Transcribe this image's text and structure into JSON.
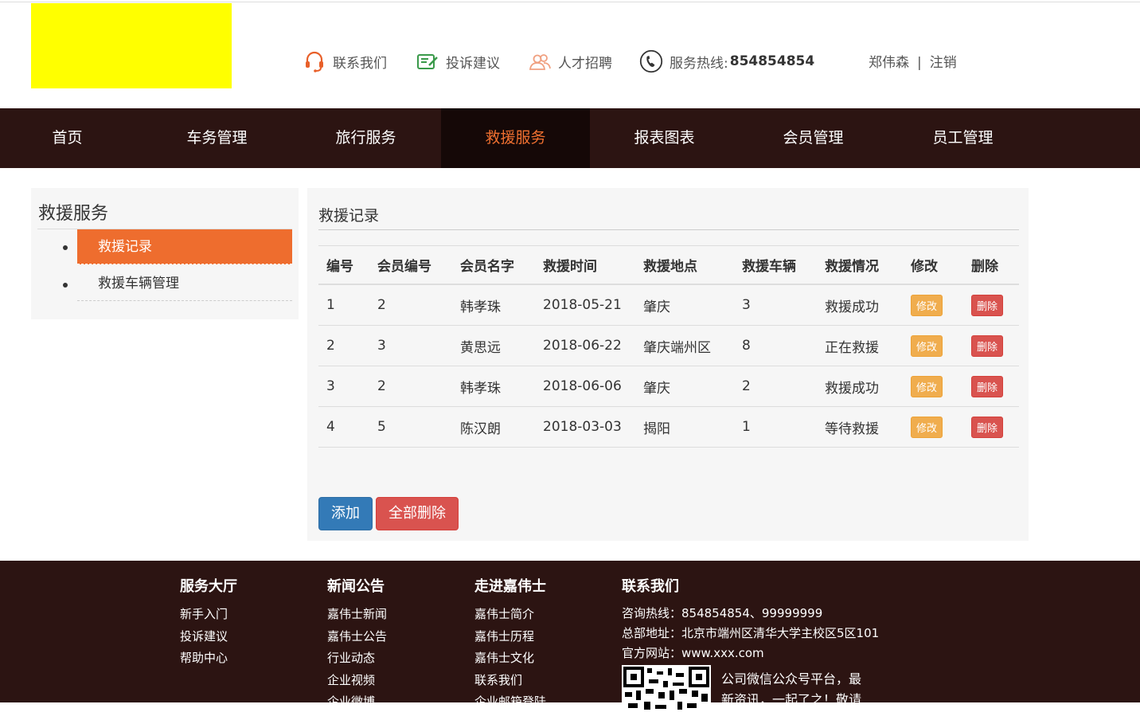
{
  "header": {
    "links": [
      {
        "label": "联系我们",
        "icon": "headset-icon"
      },
      {
        "label": "投诉建议",
        "icon": "edit-icon"
      },
      {
        "label": "人才招聘",
        "icon": "people-icon"
      }
    ],
    "hotline_label": "服务热线:",
    "hotline_number": "854854854",
    "user_name": "郑伟森",
    "separator": "|",
    "logout": "注销",
    "logo_color": "#ffff00"
  },
  "nav": {
    "items": [
      "首页",
      "车务管理",
      "旅行服务",
      "救援服务",
      "报表图表",
      "会员管理",
      "员工管理"
    ],
    "active": "救援服务"
  },
  "sidebar": {
    "title": "救援服务",
    "items": [
      "救援记录",
      "救援车辆管理"
    ],
    "active": "救援记录"
  },
  "main": {
    "title": "救援记录",
    "columns": [
      "编号",
      "会员编号",
      "会员名字",
      "救援时间",
      "救援地点",
      "救援车辆",
      "救援情况",
      "修改",
      "删除"
    ],
    "rows": [
      [
        "1",
        "2",
        "韩孝珠",
        "2018-05-21",
        "肇庆",
        "3",
        "救援成功"
      ],
      [
        "2",
        "3",
        "黄思远",
        "2018-06-22",
        "肇庆端州区",
        "8",
        "正在救援"
      ],
      [
        "3",
        "2",
        "韩孝珠",
        "2018-06-06",
        "肇庆",
        "2",
        "救援成功"
      ],
      [
        "4",
        "5",
        "陈汉朗",
        "2018-03-03",
        "揭阳",
        "1",
        "等待救援"
      ]
    ],
    "edit_label": "修改",
    "delete_label": "删除",
    "add_label": "添加",
    "delete_all_label": "全部删除"
  },
  "footer": {
    "col1": {
      "title": "服务大厅",
      "links": [
        "新手入门",
        "投诉建议",
        "帮助中心"
      ]
    },
    "col2": {
      "title": "新闻公告",
      "links": [
        "嘉伟士新闻",
        "嘉伟士公告",
        "行业动态",
        "企业视频",
        "企业微博"
      ]
    },
    "col3": {
      "title": "走进嘉伟士",
      "links": [
        "嘉伟士简介",
        "嘉伟士历程",
        "嘉伟士文化",
        "联系我们",
        "企业邮箱登陆"
      ]
    },
    "col4": {
      "title": "联系我们",
      "hotline": "咨询热线：854854854、99999999",
      "address": "总部地址：北京市端州区清华大学主校区5区101",
      "website": "官方网站：www.xxx.com",
      "qr_text": "公司微信公众号平台，最新资讯，一起了之！敬请"
    }
  }
}
